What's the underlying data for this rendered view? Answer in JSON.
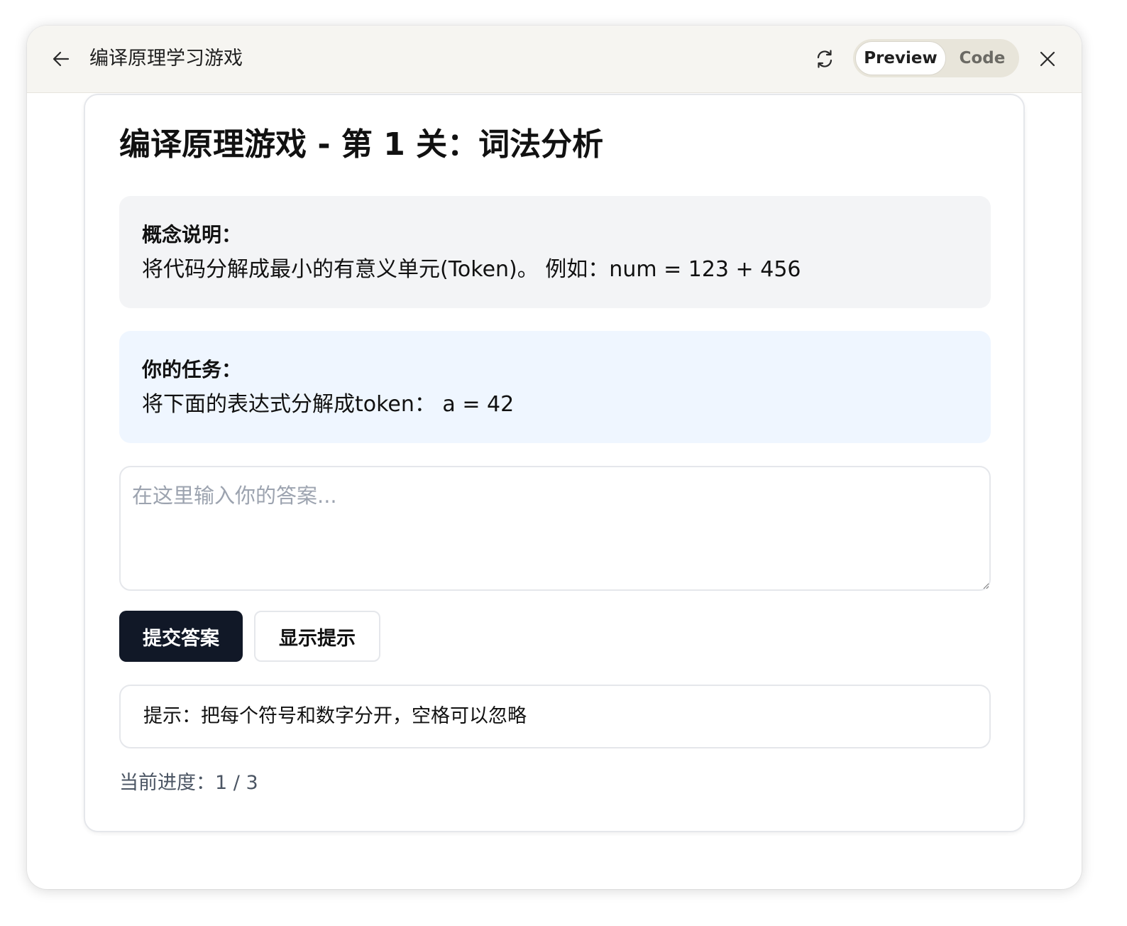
{
  "header": {
    "title": "编译原理学习游戏",
    "back_icon": "arrow-left-icon",
    "refresh_icon": "refresh-icon",
    "close_icon": "close-icon",
    "toggle": {
      "preview_label": "Preview",
      "code_label": "Code",
      "selected": "Preview"
    }
  },
  "game": {
    "title": "编译原理游戏 - 第 1 关：词法分析",
    "concept": {
      "heading": "概念说明：",
      "text": "将代码分解成最小的有意义单元(Token)。 例如：num = 123 + 456"
    },
    "task": {
      "heading": "你的任务：",
      "text": "将下面的表达式分解成token： a = 42"
    },
    "answer": {
      "value": "",
      "placeholder": "在这里输入你的答案..."
    },
    "buttons": {
      "submit_label": "提交答案",
      "hint_label": "显示提示"
    },
    "hint": {
      "text": "提示：把每个符号和数字分开，空格可以忽略"
    },
    "progress": {
      "text": "当前进度：1 / 3",
      "current": 1,
      "total": 3
    }
  },
  "colors": {
    "primary_button": "#111827",
    "task_background": "#eff6ff",
    "concept_background": "#f3f4f6",
    "titlebar_background": "#f6f5f1"
  }
}
